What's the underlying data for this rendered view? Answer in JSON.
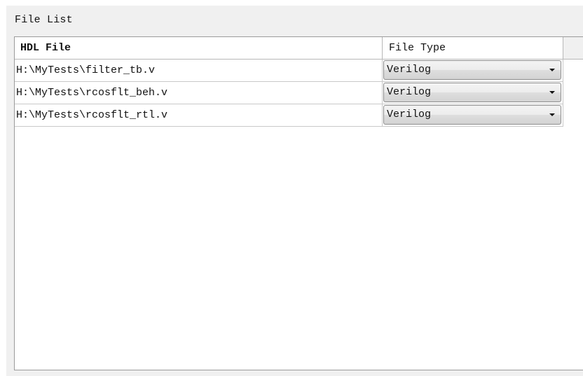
{
  "panel": {
    "title": "File List"
  },
  "table": {
    "columns": [
      "HDL File",
      "File Type"
    ],
    "rows": [
      {
        "file": "H:\\MyTests\\filter_tb.v",
        "type": "Verilog"
      },
      {
        "file": "H:\\MyTests\\rcosflt_beh.v",
        "type": "Verilog"
      },
      {
        "file": "H:\\MyTests\\rcosflt_rtl.v",
        "type": "Verilog"
      }
    ]
  },
  "icons": {
    "dropdown": "chevron-down-icon"
  }
}
